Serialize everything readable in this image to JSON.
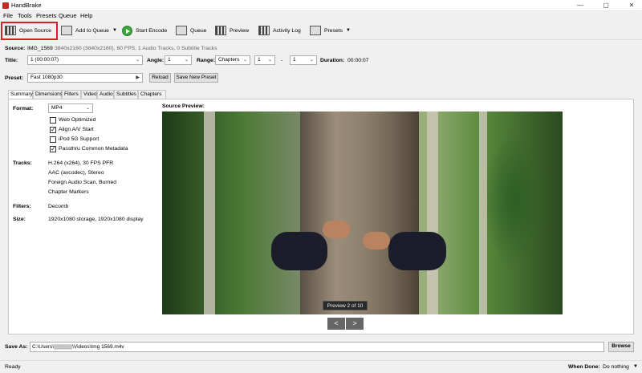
{
  "window": {
    "title": "HandBrake",
    "controls": [
      "—",
      "▢",
      "✕"
    ]
  },
  "menu": [
    "File",
    "Tools",
    "Presets",
    "Queue",
    "Help"
  ],
  "toolbar": {
    "open_source": "Open Source",
    "add_to_queue": "Add to Queue",
    "start_encode": "Start Encode",
    "queue": "Queue",
    "preview": "Preview",
    "activity_log": "Activity Log",
    "presets": "Presets"
  },
  "source": {
    "label": "Source:",
    "name": "IMG_1569",
    "info": "3840x2160 (3840x2160), 60 FPS, 1 Audio Tracks, 0 Subtitle Tracks"
  },
  "title_row": {
    "title_label": "Title:",
    "title_value": "1 (00:00:07)",
    "angle_label": "Angle:",
    "angle_value": "1",
    "range_label": "Range:",
    "range_type": "Chapters",
    "range_start": "1",
    "range_dash": "-",
    "range_end": "1",
    "duration_label": "Duration:",
    "duration_value": "00:00:07"
  },
  "preset": {
    "label": "Preset:",
    "value": "Fast 1080p30",
    "reload": "Reload",
    "save_new": "Save New Preset"
  },
  "tabs": [
    "Summary",
    "Dimensions",
    "Filters",
    "Video",
    "Audio",
    "Subtitles",
    "Chapters"
  ],
  "summary": {
    "format_label": "Format:",
    "format_value": "MP4",
    "options": [
      {
        "label": "Web Optimized",
        "checked": false
      },
      {
        "label": "Align A/V Start",
        "checked": true
      },
      {
        "label": "iPod 5G Support",
        "checked": false
      },
      {
        "label": "Passthru Common Metadata",
        "checked": true
      }
    ],
    "tracks_label": "Tracks:",
    "tracks": [
      "H.264 (x264), 30 FPS PFR",
      "AAC (avcodec), Stereo",
      "Foreign Audio Scan, Burned",
      "Chapter Markers"
    ],
    "filters_label": "Filters:",
    "filters_value": "Decomb",
    "size_label": "Size:",
    "size_value": "1920x1080 storage, 1920x1080 display"
  },
  "source_preview": {
    "label": "Source Preview:",
    "overlay": "Preview 2 of 10",
    "prev": "<",
    "next": ">"
  },
  "save_as": {
    "label": "Save As:",
    "value": "C:\\Users\\▒▒▒▒▒\\Videos\\Img 1569.m4v",
    "browse": "Browse"
  },
  "status": {
    "text": "Ready",
    "when_done_label": "When Done:",
    "when_done_value": "Do nothing"
  },
  "colors": {
    "highlight": "#d81f26",
    "play_green": "#3aa53a"
  }
}
